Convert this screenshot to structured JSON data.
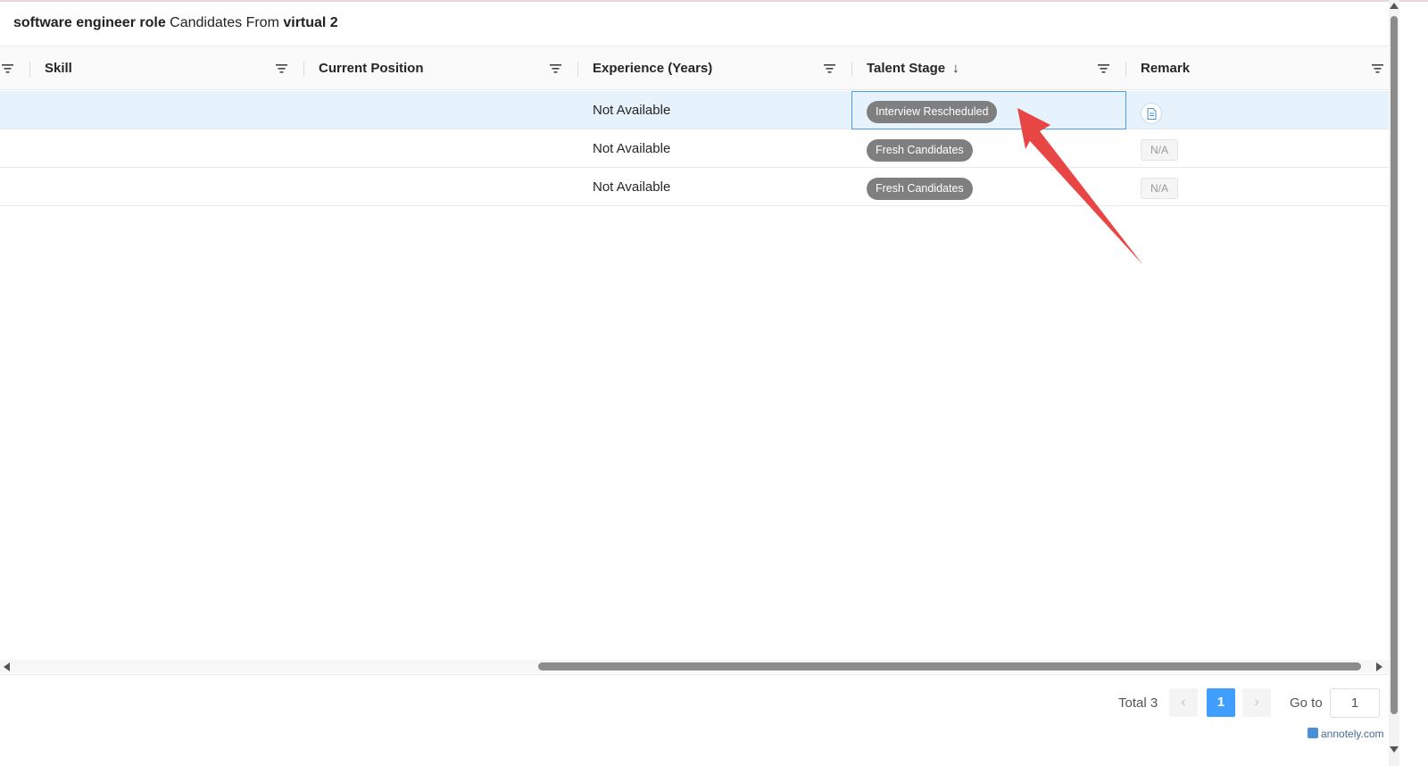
{
  "header": {
    "role": "software engineer role",
    "middle": "Candidates From",
    "source": "virtual 2"
  },
  "table": {
    "columns": [
      {
        "label": "Skill"
      },
      {
        "label": "Current Position"
      },
      {
        "label": "Experience (Years)"
      },
      {
        "label": "Talent Stage",
        "sort_icon": "↓"
      },
      {
        "label": "Remark"
      }
    ],
    "rows": [
      {
        "skill": "",
        "current_position": "",
        "experience": "Not Available",
        "talent_stage": "Interview Rescheduled",
        "remark_icon": "document-icon"
      },
      {
        "skill": "",
        "current_position": "",
        "experience": "Not Available",
        "talent_stage": "Fresh Candidates",
        "remark": "N/A"
      },
      {
        "skill": "",
        "current_position": "",
        "experience": "Not Available",
        "talent_stage": "Fresh Candidates",
        "remark": "N/A"
      }
    ]
  },
  "pagination": {
    "total_label": "Total 3",
    "prev": "‹",
    "current_page": "1",
    "next": "›",
    "goto_label": "Go to",
    "goto_value": "1"
  },
  "watermark": "annotely.com",
  "colors": {
    "accent": "#409eff",
    "selected_row": "#e6f2fc",
    "tag_bg": "#7f7f7f",
    "annotation_arrow": "#e84545"
  }
}
